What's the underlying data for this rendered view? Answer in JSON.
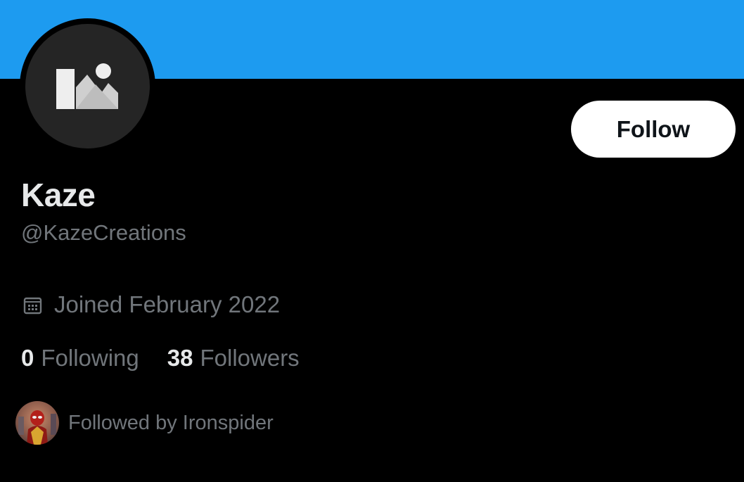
{
  "profile": {
    "display_name": "Kaze",
    "handle": "@KazeCreations",
    "joined": "Joined February 2022",
    "avatar_icon": "image-placeholder-icon",
    "banner_color": "#1d9bf0"
  },
  "actions": {
    "follow_label": "Follow"
  },
  "stats": {
    "following_count": "0",
    "following_label": "Following",
    "followers_count": "38",
    "followers_label": "Followers"
  },
  "followed_by": {
    "text": "Followed by Ironspider",
    "avatar_icon": "ironspider-avatar"
  },
  "icons": {
    "joined": "calendar-icon"
  },
  "colors": {
    "background": "#000000",
    "primary_text": "#e7e9ea",
    "secondary_text": "#71767b",
    "accent": "#1d9bf0",
    "button_bg": "#ffffff"
  }
}
